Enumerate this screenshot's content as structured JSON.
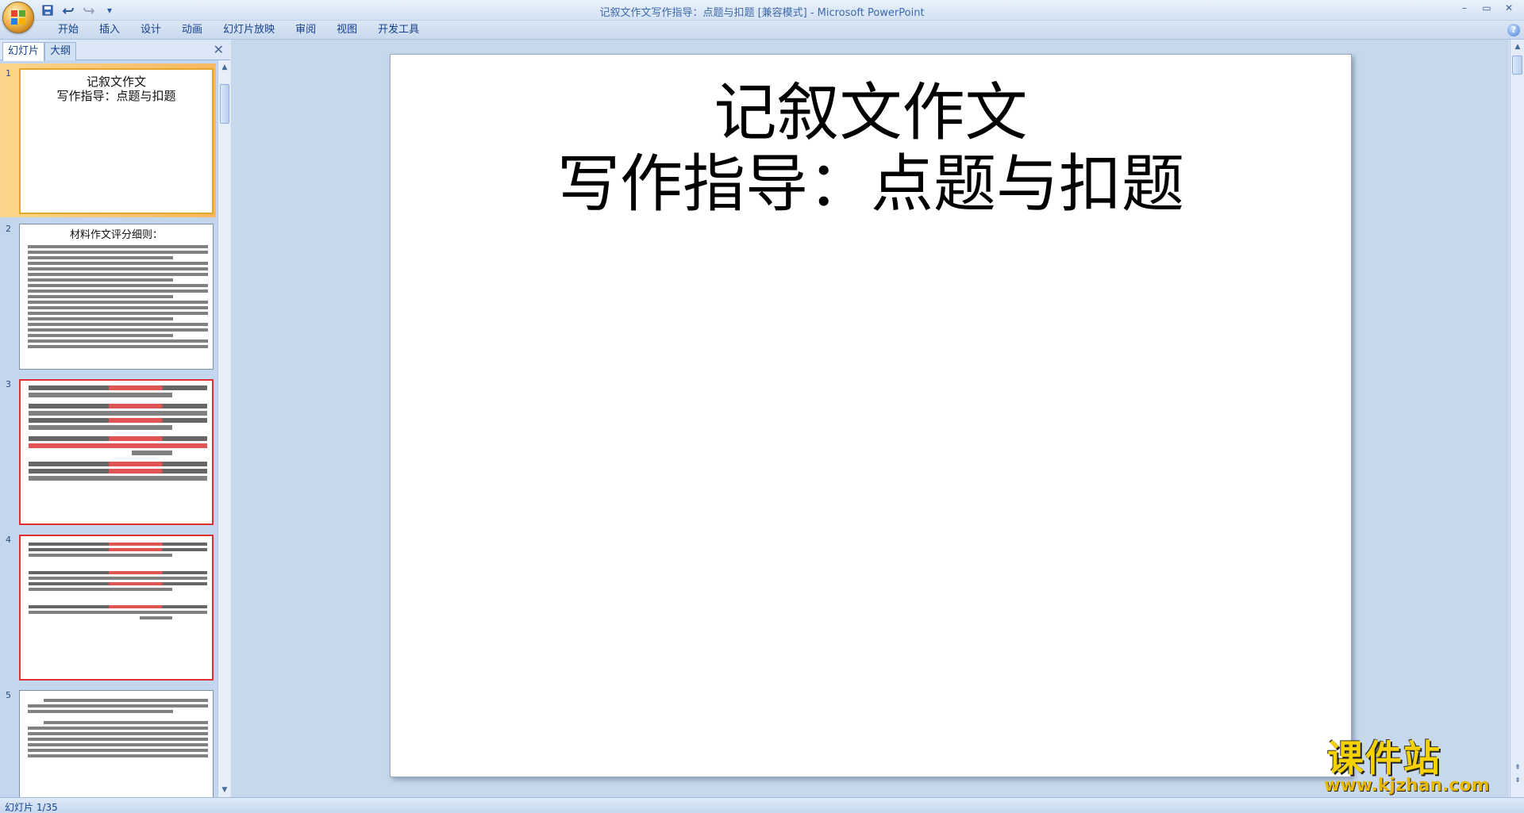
{
  "window": {
    "title": "记叙文作文写作指导：点题与扣题 [兼容模式] - Microsoft PowerPoint"
  },
  "quick_access": {
    "save_icon": "save-icon",
    "undo_icon": "undo-icon",
    "redo_icon": "redo-icon",
    "customize_icon": "customize-qat-icon"
  },
  "ribbon": {
    "tabs": [
      "开始",
      "插入",
      "设计",
      "动画",
      "幻灯片放映",
      "审阅",
      "视图",
      "开发工具"
    ],
    "help": "?"
  },
  "left_panel": {
    "tabs": [
      "幻灯片",
      "大纲"
    ],
    "close": "✕",
    "slides": [
      {
        "number": "1",
        "title_lines": [
          "记叙文作文",
          "写作指导：点题与扣题"
        ]
      },
      {
        "number": "2",
        "title_lines": [
          "材料作文评分细则："
        ]
      },
      {
        "number": "3",
        "text_lines": [
          "1、处于人生的黑夜时，那一缕看似微弱的阳光，却是一位天使。 —12周程",
          "2、种子埋在黑暗的泥土里，只要给它一缕阳光，它也能够发芽，茁壮成长。我们的人生也像种子一样，坎坷多折，只要有希望，就一定能勇敢地走下去。 —12吴观宝",
          "3、因为有你，我看透了人间的成功与失败，你似一缕阳光，照耀着我的心底，从不曾逝去。 —11 俞莹",
          "4、幸福的生活需要阳光无微不至的关注，一缕阳光即是一份暖暖的希望，金黄色的耀眼的阳光即是一份暖暖的馈赠。 —11 苏群华"
        ]
      },
      {
        "number": "4",
        "text_lines": [
          "1、太阳每天都会升起，幸福的一天从迎接的第一缕阳光开始，而父母的关怀网和老师的鼓励像温暖的阳光照在了我的心上，温暖着我。—11 苏群华",
          "2、忽然觉得夜晚变得不再漆黑，只因老师的信任与期待是我心中的那一缕阳光，驱走了失败的无奈，光明的路上，我找到了人生的方向，因为心中那一缕阳光，正驱散无形。 —11 俞莹",
          "3、和煦的阳光照射着大地，我终于找到了属于我自己的阳光，隐约听到了风儿的嬉戏声，鸟儿的歌唱声。 —12张金莲"
        ]
      },
      {
        "number": "5",
        "text_lines": [
          "中考只考上二线高中，父亲他竟然实出多年的积蓄花钱高价送我读最好的高中，我只当作是父亲面子作祟。",
          "我因为向同学借了钱买名牌鞋子，所以找借口去工地向父亲要钱。我走到工地的时候，他正在工作，他负责把砖头从一楼搬到六楼，每次挑几十个，远处一眼就看到他忙碌的身影，一顶被暴晒后变灰白的草帽，一件从我懂事开始就见到他穿的马褂……"
        ]
      }
    ]
  },
  "slide": {
    "title_line1": "记叙文作文",
    "title_line2": "写作指导：点题与扣题"
  },
  "status_bar": {
    "slide_indicator": "幻灯片 1/35"
  },
  "watermark": {
    "text": "课件站",
    "url": "www.kjzhan.com"
  },
  "colors": {
    "ribbon_text": "#15428b",
    "selected_thumb": "#f6b860",
    "red_highlight": "#d61b1b",
    "watermark": "#f5d100"
  }
}
